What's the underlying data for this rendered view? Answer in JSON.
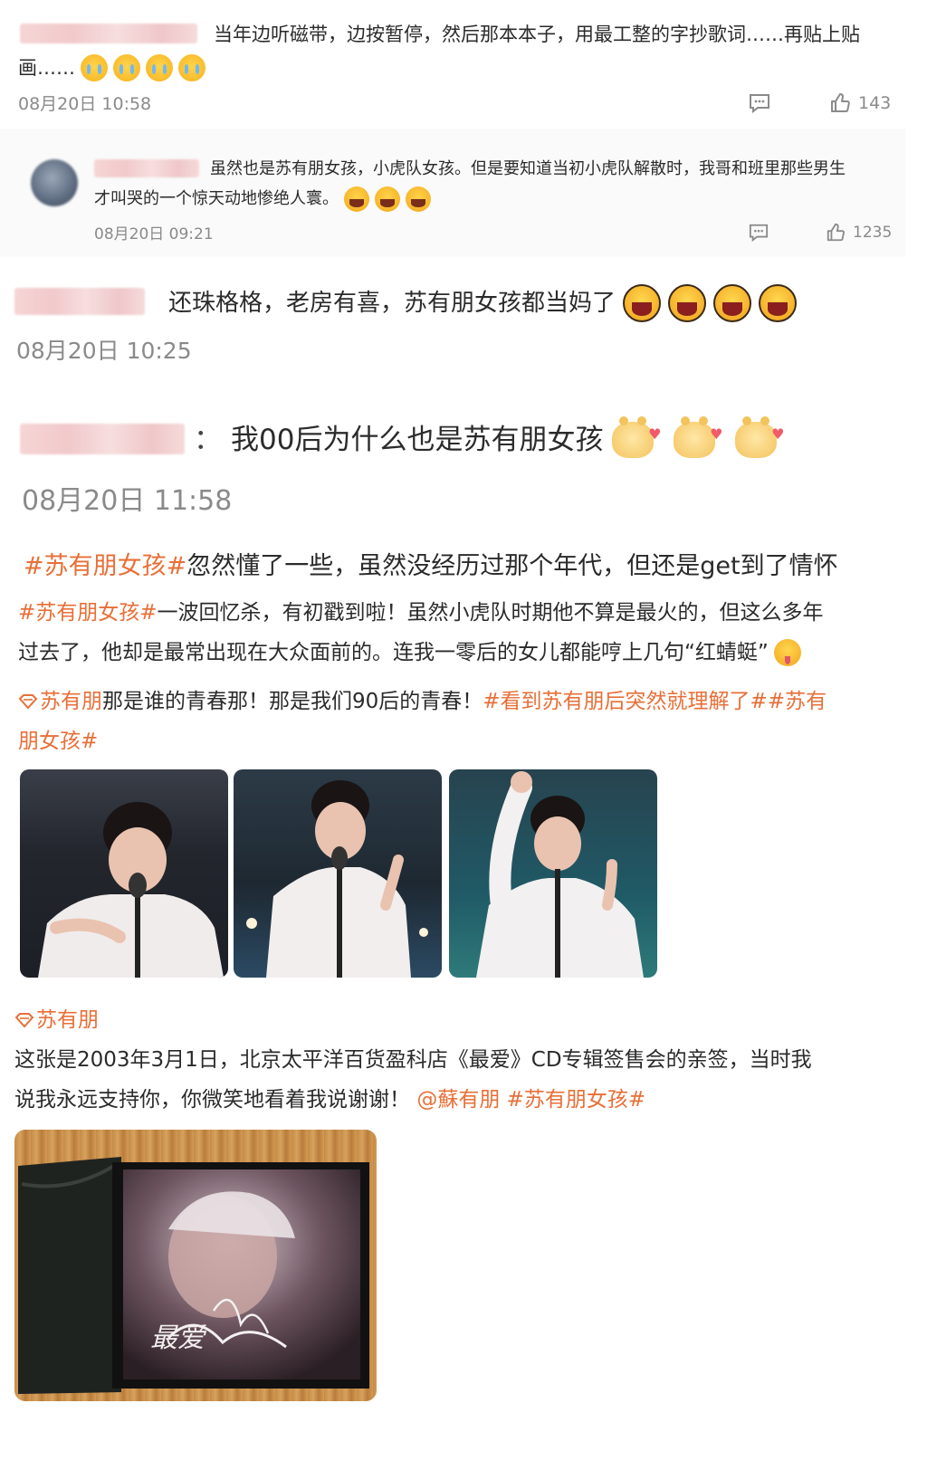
{
  "comments": [
    {
      "text_line1": "当年边听磁带，边按暂停，然后那本本子，用最工整的字抄歌词……再贴上贴",
      "text_line2": "画……",
      "time": "08月20日 10:58",
      "likes": "143",
      "reply": {
        "text_line1": "虽然也是苏有朋女孩，小虎队女孩。但是要知道当初小虎队解散时，我哥和班里那些男生",
        "text_line2": "才叫哭的一个惊天动地惨绝人寰。",
        "time": "08月20日 09:21",
        "likes": "1235"
      }
    },
    {
      "text": "还珠格格，老房有喜，苏有朋女孩都当妈了",
      "time": "08月20日 10:25"
    },
    {
      "prefix": "：",
      "text": "我00后为什么也是苏有朋女孩",
      "time": "08月20日 11:58"
    }
  ],
  "posts": [
    {
      "tag": "#苏有朋女孩#",
      "text": "忽然懂了一些，虽然没经历过那个年代，但还是get到了情怀"
    },
    {
      "tag": "#苏有朋女孩#",
      "text_line1": "一波回忆杀，有初戳到啦！虽然小虎队时期他不算是最火的，但这么多年",
      "text_line2": "过去了，他却是最常出现在大众面前的。连我一零后的女儿都能哼上几句“红蜻蜓”"
    },
    {
      "supertopic": "苏有朋",
      "text": "那是谁的青春那！那是我们90后的青春！",
      "tag2_line1": "#看到苏有朋后突然就理解了##苏有",
      "tag2_line2": "朋女孩#",
      "photo_captions": [
        "",
        "",
        ""
      ]
    },
    {
      "supertopic": "苏有朋",
      "text_line1": "这张是2003年3月1日，北京太平洋百货盈科店《最爱》CD专辑签售会的亲签，当时我",
      "text_line2": "说我永远支持你，你微笑地看着我说谢谢！",
      "mention": "@蘇有朋",
      "tag": "#苏有朋女孩#",
      "cd_title": "最爱"
    }
  ],
  "icons": {
    "comment": "comment-icon",
    "like": "thumbs-up-icon",
    "supertopic": "supertopic-diamond-icon"
  },
  "colors": {
    "tag": "#e86f37",
    "time": "#8a8a8a",
    "text": "#2b2b2b"
  }
}
